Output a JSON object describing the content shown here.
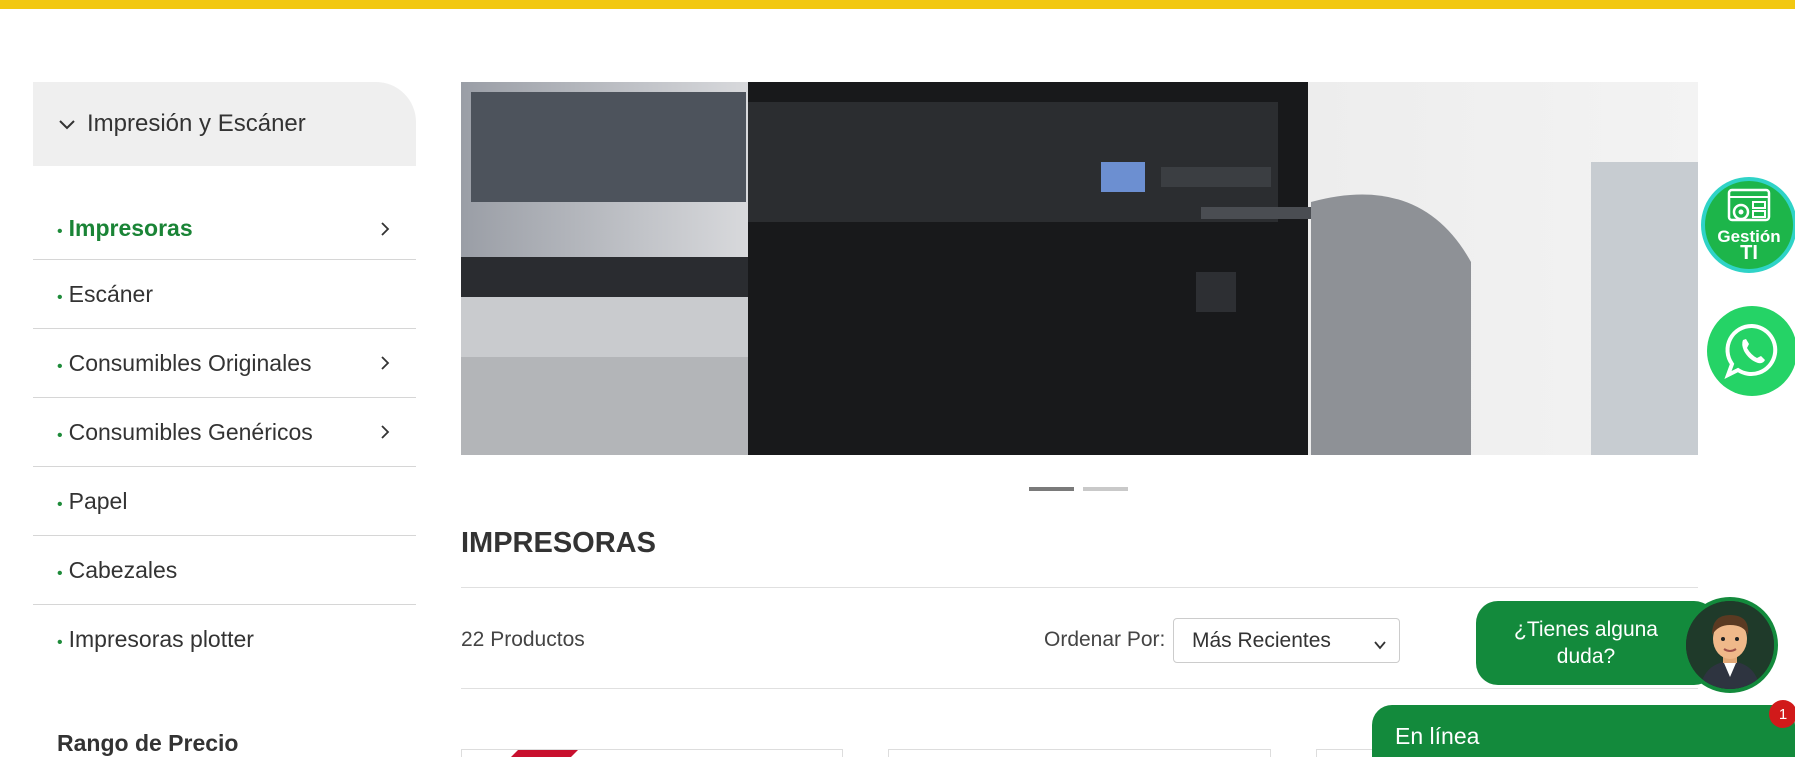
{
  "category": {
    "title": "Impresión y Escáner",
    "items": [
      {
        "label": "Impresoras",
        "active": true,
        "has_children": true
      },
      {
        "label": "Escáner",
        "active": false,
        "has_children": false
      },
      {
        "label": "Consumibles Originales",
        "active": false,
        "has_children": true
      },
      {
        "label": "Consumibles Genéricos",
        "active": false,
        "has_children": true
      },
      {
        "label": "Papel",
        "active": false,
        "has_children": false
      },
      {
        "label": "Cabezales",
        "active": false,
        "has_children": false
      },
      {
        "label": "Impresoras plotter",
        "active": false,
        "has_children": false
      }
    ],
    "bullet": "•"
  },
  "filters": {
    "price_title": "Rango de Precio"
  },
  "main": {
    "title": "IMPRESORAS",
    "product_count": "22 Productos",
    "sort_label": "Ordenar Por:",
    "sort_value": "Más Recientes"
  },
  "widgets": {
    "gestion_line1": "Gestión",
    "gestion_line2": "TI",
    "chat_line1": "¿Tienes alguna",
    "chat_line2": "duda?",
    "online_label": "En línea",
    "badge_count": "1"
  },
  "colors": {
    "accent_yellow": "#f2c811",
    "brand_green": "#138a3c",
    "whatsapp_green": "#25d366"
  }
}
